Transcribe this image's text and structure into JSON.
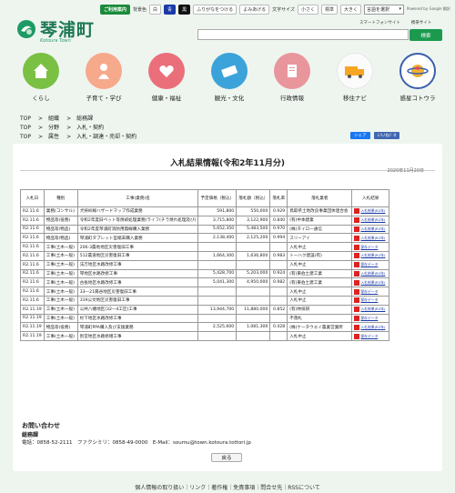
{
  "topbar": {
    "accessibility_label": "ご利用案内",
    "bg_label": "背景色",
    "bg_white": "白",
    "bg_blue": "青",
    "bg_black": "黒",
    "furigana": "ふりがなをつける",
    "read_aloud": "よみあげる",
    "font_size_label": "文字サイズ",
    "size_small": "小さく",
    "size_normal": "標準",
    "size_large": "大きく",
    "language_select": "言語を選択",
    "powered_by": "Powered by Google 翻訳"
  },
  "site": {
    "name": "琴浦町",
    "subname": "Kotoura Town"
  },
  "header": {
    "smartphone_link": "スマートフォンサイト",
    "mobile_link": "携帯サイト",
    "search_button": "検索"
  },
  "categories": [
    {
      "label": "くらし",
      "color": "#7ac043"
    },
    {
      "label": "子育て・学び",
      "color": "#f6a98b"
    },
    {
      "label": "健康・福祉",
      "color": "#ea6f7b"
    },
    {
      "label": "観光・文化",
      "color": "#3ba3d9"
    },
    {
      "label": "行政情報",
      "color": "#e9959c"
    },
    {
      "label": "移住ナビ",
      "color": "#fbfbfb"
    },
    {
      "label": "感星コトウラ",
      "color": "#ffffff"
    }
  ],
  "breadcrumbs": [
    [
      "TOP",
      "組織",
      "総務課"
    ],
    [
      "TOP",
      "分野",
      "入札・契約"
    ],
    [
      "TOP",
      "属性",
      "入札・調達・売却・契約"
    ]
  ],
  "share": {
    "facebook": "シェア",
    "like": "いいね！0"
  },
  "page": {
    "title": "入札結果情報(令和2年11月分)",
    "date": "2020年11月20日"
  },
  "table": {
    "headers": [
      "入札日",
      "種別",
      "工事(業務)名",
      "予定価格（税込）",
      "落札額（税込）",
      "落札率",
      "落札業者",
      "入札結果"
    ],
    "rows": [
      [
        "R2.11.6",
        "業務(コンサル)",
        "犬挟峠線ハザードマップ作成業務",
        "591,800",
        "550,000",
        "0.929",
        "鳥取県土地改良事業団体連合会",
        "入札結果(R2年)"
      ],
      [
        "R2.11.6",
        "物品等(役務)",
        "令和2年度旧ペット等焼却処理業務(ライフ(チラ焼れ処理及び)",
        "3,715,800",
        "3,122,900",
        "0.840",
        "(有)中本建業",
        "入札結果(R2年)"
      ],
      [
        "R2.11.6",
        "物品等(物品)",
        "令和2年度琴浦町消防用無線購入業務",
        "5,652,350",
        "5,483,500",
        "0.970",
        "(株)タイロー通信",
        "入札結果(R2年)"
      ],
      [
        "R2.11.6",
        "物品等(物品)",
        "琴浦町タブレット型端末購入業務",
        "2,138,400",
        "2,125,200",
        "0.994",
        "スリーアイ",
        "入札結果(R2年)"
      ],
      [
        "R2.11.6",
        "工事(土木一般)",
        "206-3農地地区災害復旧工事",
        "",
        "",
        "",
        "入札中止",
        "保存データ"
      ],
      [
        "R2.11.6",
        "工事(土木一般)",
        "512農道地区災害復旧工事",
        "1,664,300",
        "1,636,800",
        "0.983",
        "トーハク建設(有)",
        "入札結果(R2年)"
      ],
      [
        "R2.11.6",
        "工事(土木一般)",
        "法万地区水路改修工事",
        "",
        "",
        "",
        "入札中止",
        "保存データ"
      ],
      [
        "R2.11.6",
        "工事(土木一般)",
        "琴地区水路改修工事",
        "5,428,700",
        "5,203,000",
        "0.924",
        "(有)東伯土建工業",
        "入札結果(R2年)"
      ],
      [
        "R2.11.6",
        "工事(土木一般)",
        "古長地区水路改修工事",
        "5,041,300",
        "4,950,000",
        "0.982",
        "(有)東伯土建工業",
        "入札結果(R2年)"
      ],
      [
        "R2.11.6",
        "工事(土木一般)",
        "33―21陽谷地区災害復旧工事",
        "",
        "",
        "",
        "入札中止",
        "保存データ"
      ],
      [
        "R2.11.6",
        "工事(土木一般)",
        "319公文地区災害復旧工事",
        "",
        "",
        "",
        "入札中止",
        "保存データ"
      ],
      [
        "R2.11.19",
        "工事(土木一般)",
        "公共八幡地区(32―4工区)工事",
        "13,944,700",
        "11,880,000",
        "0.852",
        "(有)林技研",
        "入札結果(R2年)"
      ],
      [
        "R2.11.19",
        "工事(土木一般)",
        "杉下地区水路改修工事",
        "",
        "",
        "",
        "不落札",
        "保存データ"
      ],
      [
        "R2.11.19",
        "物品等(役務)",
        "琴浦町PPA購入及び支援業務",
        "2,525,600",
        "1,081,300",
        "0.428",
        "(株)ケータウエイ農業営業所",
        "入札結果(R2年)"
      ],
      [
        "R2.11.19",
        "工事(土木一般)",
        "別宮地区水路修繕工事",
        "",
        "",
        "",
        "入札中止",
        "保存データ"
      ]
    ]
  },
  "contact": {
    "heading": "お問い合わせ",
    "department": "総務課",
    "info": "電話：0858-52-2111　ファクシミリ：0858-49-0000　E-Mail：soumu@town.kotoura.tottori.jp"
  },
  "back_button": "戻る",
  "footer": "個人情報の取り扱い｜リンク｜著作権｜免責事項｜問合せ先｜RSSについて"
}
